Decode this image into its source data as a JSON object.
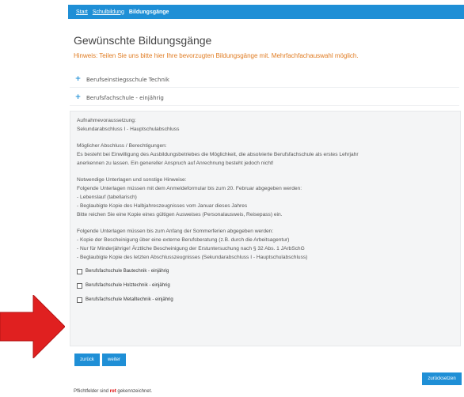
{
  "breadcrumb": {
    "start": "Start",
    "schulbildung": "Schulbildung",
    "current": "Bildungsgänge"
  },
  "page": {
    "title": "Gewünschte Bildungsgänge",
    "hint": "Hinweis: Teilen Sie uns bitte hier Ihre bevorzugten Bildungsgänge mit. Mehrfachfachauswahl möglich."
  },
  "accordion": [
    {
      "label": "Berufseinstiegsschule Technik"
    },
    {
      "label": "Berufsfachschule - einjährig"
    }
  ],
  "details": {
    "lines": [
      "Aufnahmevoraussetzung:",
      "Sekundarabschluss I - Hauptschulabschluss",
      "",
      "Möglicher Abschluss / Berechtigungen:",
      "Es besteht bei Einwilligung des Ausbildungsbetriebes die Möglichkeit, die absolvierte Berufsfachschule als erstes Lehrjahr",
      "anerkennen zu lassen. Ein genereller Anspruch auf Anrechnung besteht jedoch nicht!",
      "",
      "Notwendige Unterlagen und sonstige Hinweise:",
      "Folgende Unterlagen müssen mit dem Anmeldeformular bis zum 20. Februar abgegeben werden:",
      "- Lebenslauf (tabellarisch)",
      "- Beglaubigte Kopie des Halbjahreszeugnisses vom Januar dieses Jahres",
      "Bitte reichen Sie eine Kopie eines gültigen Ausweises (Personalausweis, Reisepass) ein.",
      "",
      "Folgende Unterlagen müssen bis zum Anfang der Sommerferien abgegeben werden:",
      "- Kopie der Bescheinigung über eine externe Berufsberatung (z.B. durch die Arbeitsagentur)",
      "- Nur für Minderjährige! Ärztliche Bescheinigung der Erstuntersuchung nach § 32 Abs. 1 JArbSchG",
      "- Beglaubigte Kopie des letzten Abschlusszeugnisses (Sekundarabschluss I - Hauptschulabschluss)"
    ],
    "checkboxes": [
      {
        "label": "Berufsfachschule Bautechnik - einjährig",
        "checked": false
      },
      {
        "label": "Berufsfachschule Holztechnik - einjährig",
        "checked": false
      },
      {
        "label": "Berufsfachschule Metalltechnik - einjährig",
        "checked": false
      }
    ]
  },
  "buttons": {
    "back": "zurück",
    "next": "weiter",
    "reset": "zurücksetzen"
  },
  "footer": {
    "before": "Pflichtfelder sind ",
    "red_word": "rot",
    "after": " gekennzeichnet."
  },
  "colors": {
    "accent": "#1f8fd6",
    "hint": "#e07b21",
    "arrow": "#e02020"
  },
  "icons": {
    "expand": "plus-icon",
    "pointer": "red-arrow-icon"
  }
}
